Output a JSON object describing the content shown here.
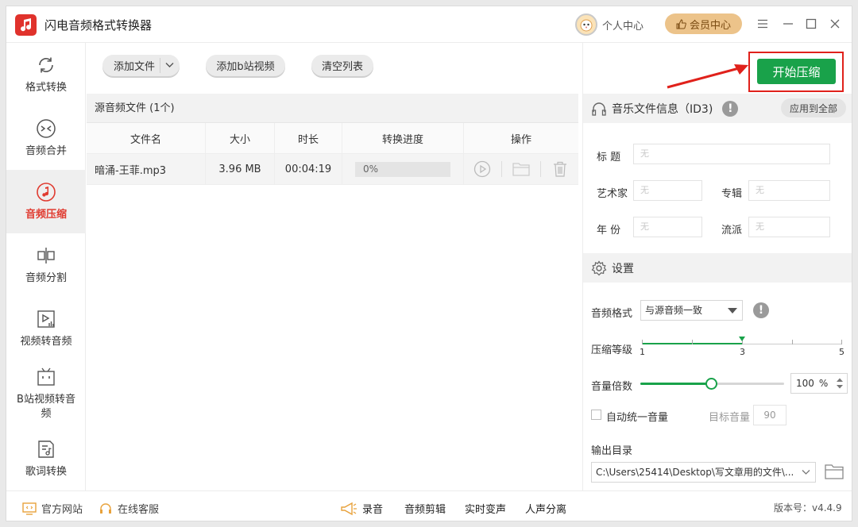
{
  "app": {
    "title": "闪电音频格式转换器"
  },
  "titlebar": {
    "user_center": "个人中心",
    "member_center": "会员中心"
  },
  "sidebar": {
    "items": [
      {
        "label": "格式转换",
        "icon": "format-convert-icon"
      },
      {
        "label": "音频合并",
        "icon": "merge-icon"
      },
      {
        "label": "音频压缩",
        "icon": "compress-icon",
        "active": true
      },
      {
        "label": "音频分割",
        "icon": "split-icon"
      },
      {
        "label": "视频转音频",
        "icon": "video-to-audio-icon"
      },
      {
        "label": "B站视频转音频",
        "icon": "bilibili-icon"
      },
      {
        "label": "歌词转换",
        "icon": "lyrics-icon"
      }
    ]
  },
  "toolbar": {
    "add_file": "添加文件",
    "add_bilibili": "添加b站视频",
    "clear_list": "清空列表"
  },
  "file_panel": {
    "header": "源音频文件 (1个)",
    "columns": [
      "文件名",
      "大小",
      "时长",
      "转换进度",
      "操作"
    ],
    "rows": [
      {
        "name": "暗涌-王菲.mp3",
        "size": "3.96 MB",
        "duration": "00:04:19",
        "progress": "0%",
        "progress_value": 0
      }
    ]
  },
  "right_panel": {
    "start_button": "开始压缩",
    "id3": {
      "title": "音乐文件信息（ID3)",
      "apply_all": "应用到全部",
      "fields": {
        "title_label": "标  题",
        "artist_label": "艺术家",
        "album_label": "专辑",
        "year_label": "年  份",
        "genre_label": "流派",
        "placeholder": "无"
      }
    },
    "settings": {
      "title": "设置",
      "format_label": "音频格式",
      "format_value": "与源音频一致",
      "level_label": "压缩等级",
      "level_ticks": [
        "1",
        "3",
        "5"
      ],
      "level_value": 3,
      "level_min": 1,
      "level_max": 5,
      "volume_label": "音量倍数",
      "volume_value": "100",
      "volume_unit": "%",
      "volume_fraction": 0.49,
      "auto_volume_label": "自动统一音量",
      "target_volume_label": "目标音量",
      "target_volume_value": "90",
      "output_label": "输出目录",
      "output_path": "C:\\Users\\25414\\Desktop\\写文章用的文件\\..."
    }
  },
  "bottombar": {
    "official_site": "官方网站",
    "online_service": "在线客服",
    "record": "录音",
    "audio_edit": "音频剪辑",
    "realtime_voice": "实时变声",
    "vocal_separate": "人声分离",
    "version": "版本号：v4.4.9"
  },
  "colors": {
    "accent": "#e03b30",
    "start_button": "#19a24a",
    "member": "#ecc38a",
    "annotation": "#e0211b"
  }
}
